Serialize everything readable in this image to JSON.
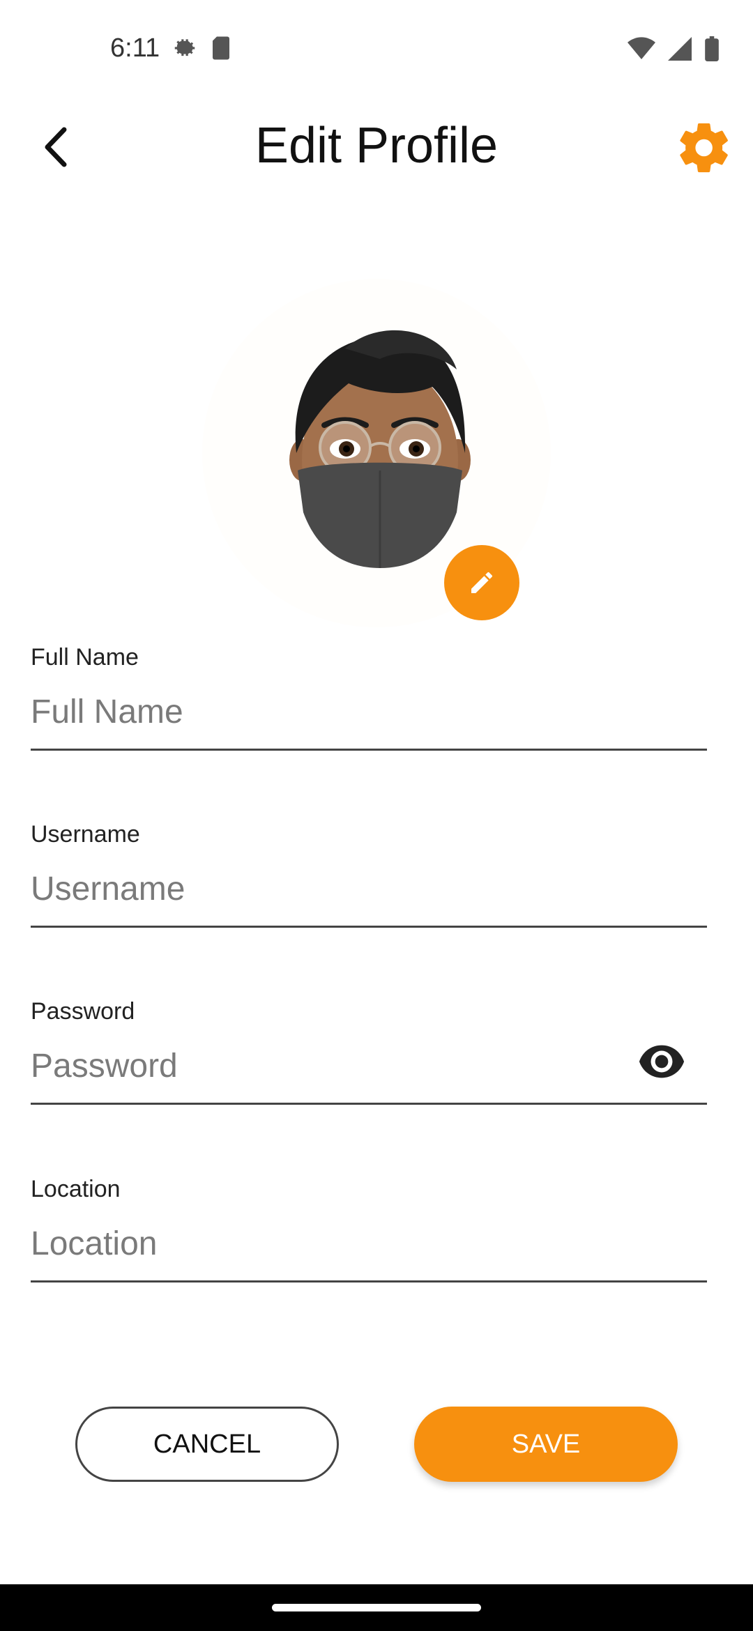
{
  "status": {
    "time": "6:11",
    "icons_left": [
      "settings-gear-icon",
      "sd-card-icon"
    ],
    "icons_right": [
      "wifi-icon",
      "signal-icon",
      "battery-icon"
    ]
  },
  "header": {
    "title": "Edit Profile",
    "back_icon": "chevron-left-icon",
    "settings_icon": "gear-icon"
  },
  "profile": {
    "avatar": "memoji-avatar-with-mask",
    "edit_icon": "pencil-icon"
  },
  "form": {
    "full_name": {
      "label": "Full Name",
      "placeholder": "Full Name",
      "value": ""
    },
    "username": {
      "label": "Username",
      "placeholder": "Username",
      "value": ""
    },
    "password": {
      "label": "Password",
      "placeholder": "Password",
      "value": "",
      "toggle_icon": "eye-icon"
    },
    "location": {
      "label": "Location",
      "placeholder": "Location",
      "value": ""
    }
  },
  "actions": {
    "cancel_label": "CANCEL",
    "save_label": "SAVE"
  },
  "colors": {
    "accent": "#f7900f",
    "text": "#111111",
    "underline": "#444444"
  }
}
